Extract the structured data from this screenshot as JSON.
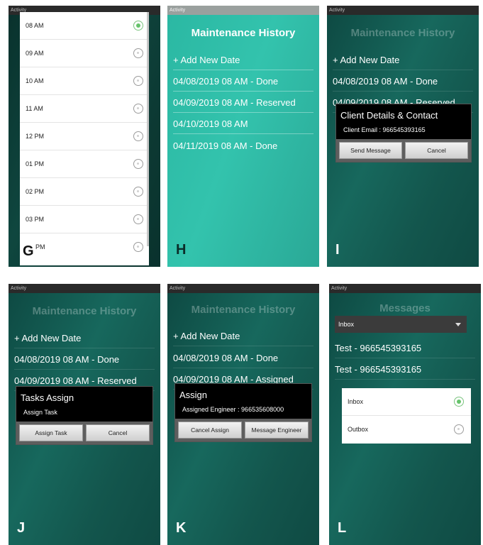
{
  "panels": {
    "G": {
      "status": "Activity",
      "letter": "G",
      "times": [
        {
          "label": "08 AM",
          "selected": true
        },
        {
          "label": "09 AM",
          "selected": false
        },
        {
          "label": "10 AM",
          "selected": false
        },
        {
          "label": "11 AM",
          "selected": false
        },
        {
          "label": "12 PM",
          "selected": false
        },
        {
          "label": "01 PM",
          "selected": false
        },
        {
          "label": "02 PM",
          "selected": false
        },
        {
          "label": "03 PM",
          "selected": false
        },
        {
          "label": "PM",
          "selected": false
        }
      ]
    },
    "H": {
      "status": "Activity",
      "title": "Maintenance History",
      "add_new": "+ Add New Date",
      "items": [
        "04/08/2019 08 AM - Done",
        "04/09/2019 08 AM - Reserved",
        "04/10/2019 08 AM",
        "04/11/2019 08 AM - Done"
      ],
      "letter": "H"
    },
    "I": {
      "status": "Activity",
      "title": "Maintenance History",
      "add_new": "+ Add New Date",
      "items": [
        "04/08/2019 08 AM - Done",
        "04/09/2019 08 AM - Reserved"
      ],
      "dialog": {
        "title": "Client Details & Contact",
        "message": "Client Email : 966545393165",
        "btn_send": "Send Message",
        "btn_cancel": "Cancel"
      },
      "letter": "I"
    },
    "J": {
      "status": "Activity",
      "title": "Maintenance History",
      "add_new": "+ Add New Date",
      "items": [
        "04/08/2019 08 AM - Done",
        "04/09/2019 08 AM - Reserved"
      ],
      "dialog": {
        "title": "Tasks Assign",
        "message": "Assign Task",
        "btn_assign": "Assign Task",
        "btn_cancel": "Cancel"
      },
      "letter": "J"
    },
    "K": {
      "status": "Activity",
      "title": "Maintenance History",
      "add_new": "+ Add New Date",
      "items": [
        "04/08/2019 08 AM - Done",
        "04/09/2019 08 AM - Assigned"
      ],
      "dialog": {
        "title": "Assign",
        "message": "Assigned Engineer : 966535608000",
        "btn_cancel_assign": "Cancel Assign",
        "btn_message": "Message Engineer"
      },
      "letter": "K"
    },
    "L": {
      "status": "Activity",
      "title": "Messages",
      "dropdown_value": "Inbox",
      "items": [
        "Test - 966545393165",
        "Test - 966545393165"
      ],
      "options": [
        {
          "label": "Inbox",
          "selected": true
        },
        {
          "label": "Outbox",
          "selected": false
        }
      ],
      "letter": "L"
    }
  },
  "colors": {
    "teal_dark": "#13564d",
    "teal_bright": "#33c3ad",
    "radio_selected": "#66c36b"
  }
}
